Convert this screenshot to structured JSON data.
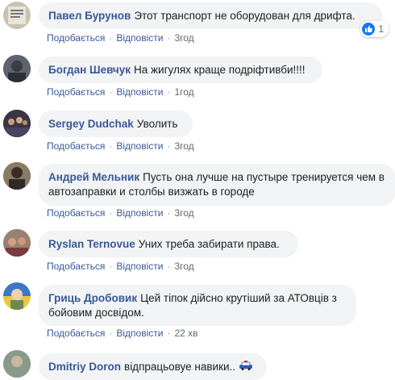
{
  "comments": [
    {
      "author": "Павел Бурунов",
      "text": "Этот транспорт не оборудован для дрифта.",
      "like": "Подобається",
      "reply": "Відповісти",
      "time": "3год",
      "reactions": "1",
      "avatar_color": "#b8b0a0"
    },
    {
      "author": "Богдан Шевчук",
      "text": "На жигулях краще подріфтивби!!!!",
      "like": "Подобається",
      "reply": "Відповісти",
      "time": "1год",
      "avatar_color": "#4a4f58"
    },
    {
      "author": "Sergey Dudchak",
      "text": "Уволить",
      "like": "Подобається",
      "reply": "Відповісти",
      "time": "3год",
      "avatar_color": "#2c2a33"
    },
    {
      "author": "Андрей Мельник",
      "text": "Пусть она лучше на пустыре тренируется чем в автозаправки и столбы визжать в городе",
      "like": "Подобається",
      "reply": "Відповісти",
      "time": "3год",
      "avatar_color": "#6b5a4a"
    },
    {
      "author": "Ryslan Ternovue",
      "text": "Уних треба забирати права.",
      "like": "Подобається",
      "reply": "Відповісти",
      "time": "3год",
      "avatar_color": "#8a6a58"
    },
    {
      "author": "Гриць Дробовик",
      "text": "Цей тіпок дійсно крутіший за АТОвців з бойовим досвідом.",
      "like": "Подобається",
      "reply": "Відповісти",
      "time": "22 хв",
      "avatar_color": "#d4b44a"
    },
    {
      "author": "Dmitriy Doron",
      "text": "відпрацьовуе навики..",
      "avatar_color": "#7a8a7a"
    }
  ]
}
